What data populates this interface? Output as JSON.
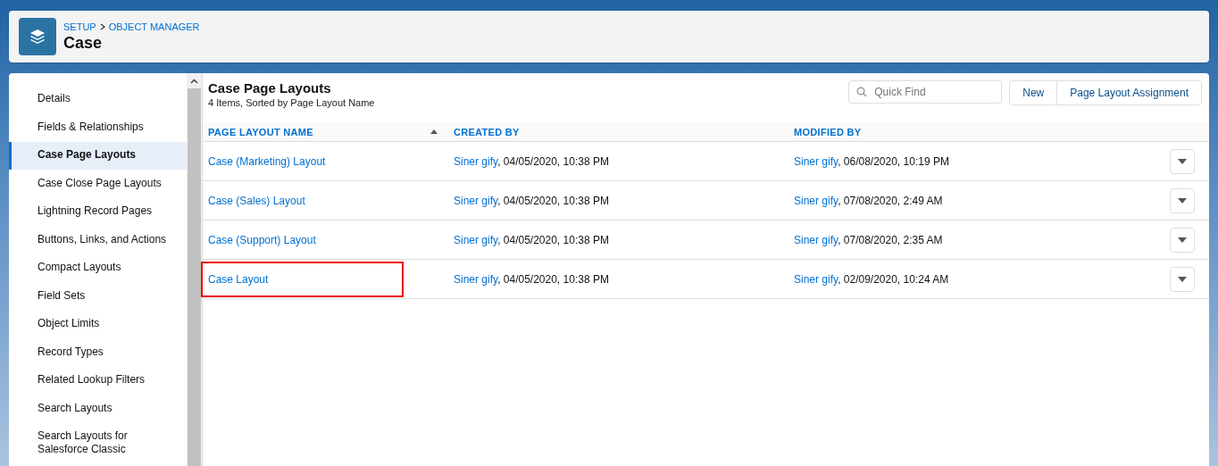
{
  "breadcrumb": [
    {
      "label": "SETUP"
    },
    {
      "label": "OBJECT MANAGER"
    }
  ],
  "object_title": "Case",
  "sidebar": {
    "items": [
      {
        "label": "Details",
        "selected": false
      },
      {
        "label": "Fields & Relationships",
        "selected": false
      },
      {
        "label": "Case Page Layouts",
        "selected": true
      },
      {
        "label": "Case Close Page Layouts",
        "selected": false
      },
      {
        "label": "Lightning Record Pages",
        "selected": false
      },
      {
        "label": "Buttons, Links, and Actions",
        "selected": false
      },
      {
        "label": "Compact Layouts",
        "selected": false
      },
      {
        "label": "Field Sets",
        "selected": false
      },
      {
        "label": "Object Limits",
        "selected": false
      },
      {
        "label": "Record Types",
        "selected": false
      },
      {
        "label": "Related Lookup Filters",
        "selected": false
      },
      {
        "label": "Search Layouts",
        "selected": false
      },
      {
        "label": "Search Layouts for Salesforce Classic",
        "selected": false
      }
    ]
  },
  "page": {
    "title": "Case Page Layouts",
    "subtitle": "4 Items, Sorted by Page Layout Name"
  },
  "search": {
    "placeholder": "Quick Find"
  },
  "buttons": [
    "New",
    "Page Layout Assignment"
  ],
  "table": {
    "columns": [
      {
        "label": "PAGE LAYOUT NAME",
        "sorted": true
      },
      {
        "label": "CREATED BY",
        "sorted": false
      },
      {
        "label": "MODIFIED BY",
        "sorted": false
      }
    ],
    "rows": [
      {
        "name": "Case (Marketing) Layout",
        "created_user": "Siner gify",
        "created_date": ", 04/05/2020, 10:38 PM",
        "modified_user": "Siner gify",
        "modified_date": ", 06/08/2020, 10:19 PM",
        "highlighted": false
      },
      {
        "name": "Case (Sales) Layout",
        "created_user": "Siner gify",
        "created_date": ", 04/05/2020, 10:38 PM",
        "modified_user": "Siner gify",
        "modified_date": ", 07/08/2020, 2:49 AM",
        "highlighted": false
      },
      {
        "name": "Case (Support) Layout",
        "created_user": "Siner gify",
        "created_date": ", 04/05/2020, 10:38 PM",
        "modified_user": "Siner gify",
        "modified_date": ", 07/08/2020, 2:35 AM",
        "highlighted": false
      },
      {
        "name": "Case Layout",
        "created_user": "Siner gify",
        "created_date": ", 04/05/2020, 10:38 PM",
        "modified_user": "Siner gify",
        "modified_date": ", 02/09/2020, 10:24 AM",
        "highlighted": true
      }
    ]
  }
}
